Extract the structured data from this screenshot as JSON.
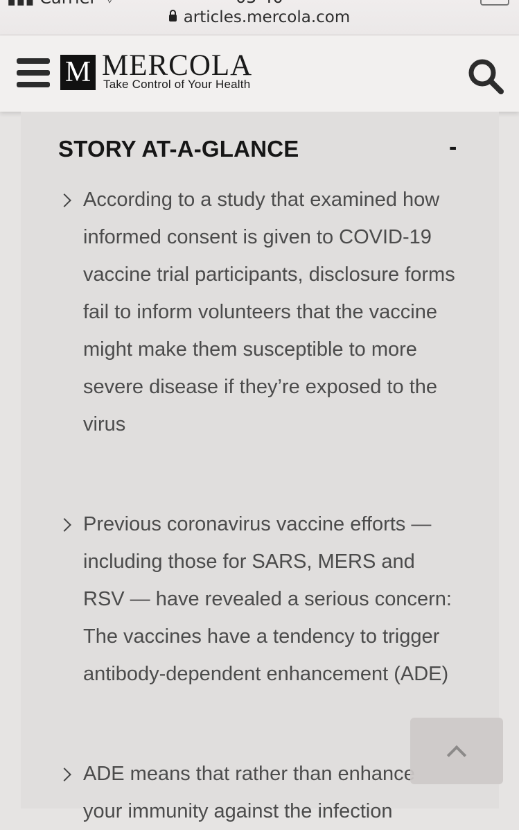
{
  "browser": {
    "url": "articles.mercola.com"
  },
  "header": {
    "logo_letter": "M",
    "brand": "MERCOLA",
    "tagline": "Take Control of Your Health",
    "menu_icon": "hamburger-menu-icon",
    "search_icon": "search-icon"
  },
  "glance": {
    "title": "STORY AT-A-GLANCE",
    "collapse_label": "-",
    "items": [
      "According to a study that examined how informed consent is given to COVID-19 vaccine trial participants, disclosure forms fail to inform volunteers that the vaccine might make them susceptible to more severe disease if they’re exposed to the virus",
      "Previous coronavirus vaccine efforts — including those for SARS, MERS and RSV — have revealed a serious concern: The vaccines have a tendency to trigger antibody-dependent enhancement (ADE)",
      "ADE means that rather than enhance your immunity against the infection"
    ]
  },
  "scroll_top": {
    "icon": "chevron-up-icon"
  }
}
